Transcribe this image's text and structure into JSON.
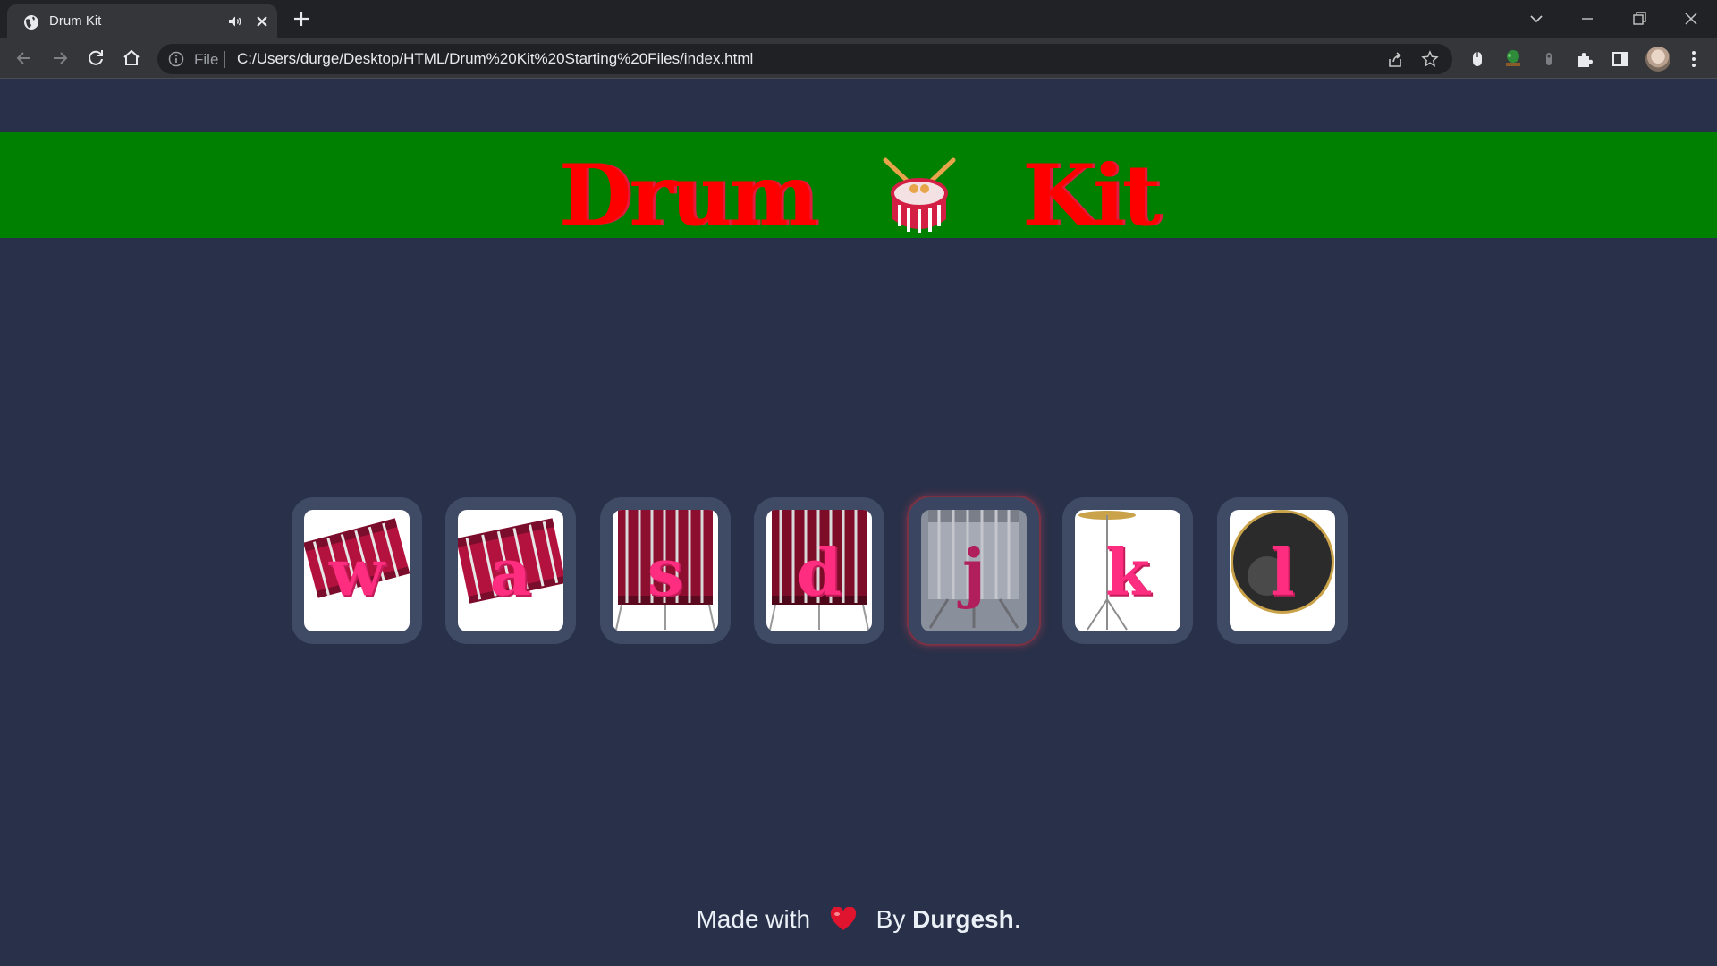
{
  "browser": {
    "tab_title": "Drum Kit",
    "omnibox_scheme": "File",
    "url": "C:/Users/durge/Desktop/HTML/Drum%20Kit%20Starting%20Files/index.html"
  },
  "page": {
    "title_left": "Drum",
    "title_right": "Kit",
    "title_emoji": "drum-emoji",
    "colors": {
      "background": "#283149",
      "header_band": "#008000",
      "title": "#ff0000",
      "drum_button": "#3f4a65",
      "letter": "#ff2d7f",
      "drum_red": "#b3123f"
    },
    "drums": [
      {
        "key": "w",
        "art": "tom-1",
        "pressed": false
      },
      {
        "key": "a",
        "art": "tom-2",
        "pressed": false
      },
      {
        "key": "s",
        "art": "tom-3",
        "pressed": false
      },
      {
        "key": "d",
        "art": "tom-4",
        "pressed": false
      },
      {
        "key": "j",
        "art": "snare",
        "pressed": true
      },
      {
        "key": "k",
        "art": "crash",
        "pressed": false
      },
      {
        "key": "l",
        "art": "kick",
        "pressed": false
      }
    ],
    "footer": {
      "prefix": "Made with",
      "heart": "heart-emoji",
      "by": "By",
      "author": "Durgesh",
      "suffix": "."
    }
  }
}
